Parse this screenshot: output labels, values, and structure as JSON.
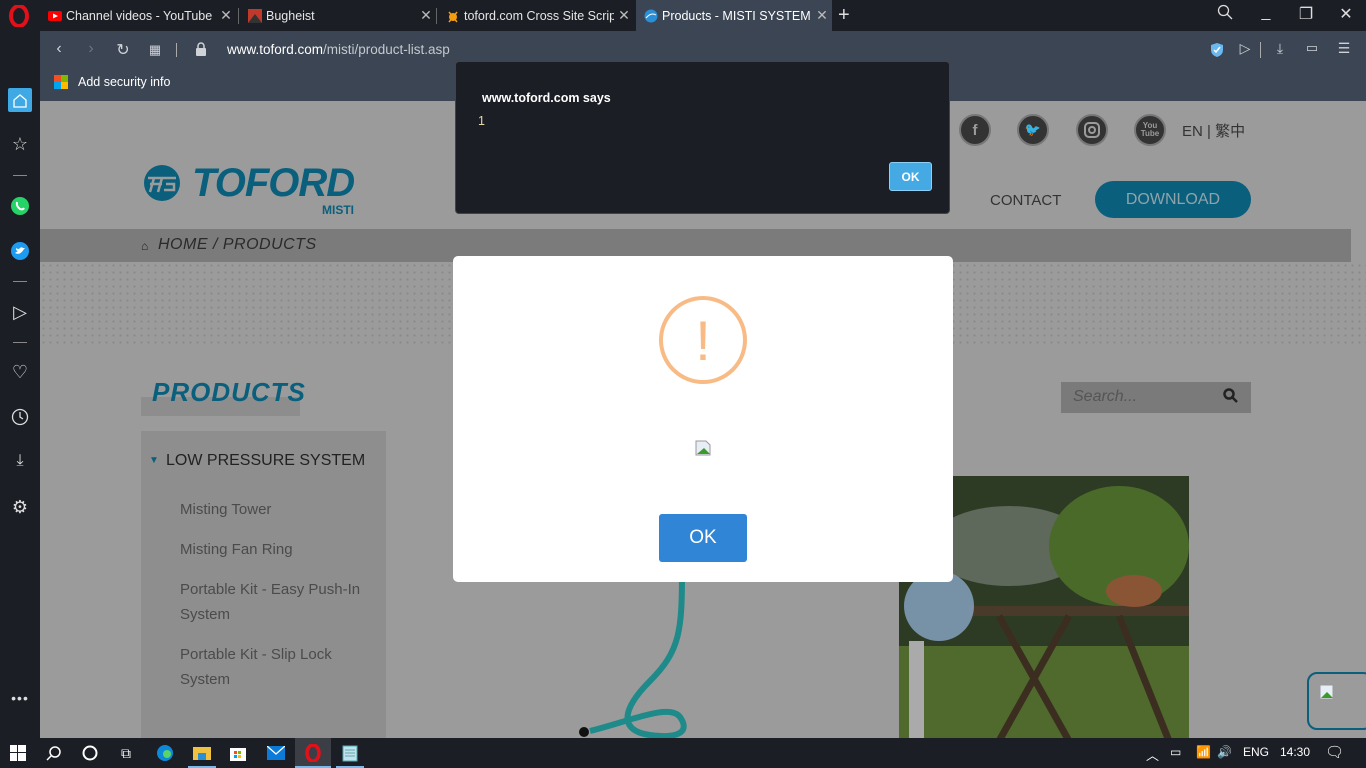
{
  "browser": {
    "tabs": [
      {
        "title": "Channel videos - YouTube Studio",
        "favicon": "youtube-icon",
        "active": false
      },
      {
        "title": "Bugheist",
        "favicon": "bugheist-icon",
        "active": false
      },
      {
        "title": "toford.com Cross Site Scripting",
        "favicon": "bug-icon",
        "active": false
      },
      {
        "title": "Products - MISTI SYSTEM",
        "favicon": "globe-icon",
        "active": true
      }
    ],
    "url_domain": "www.toford.com",
    "url_path": "/misti/product-list.asp",
    "bookmark": "Add security info",
    "sidebar_icons": [
      "home-icon",
      "star-icon",
      "whatsapp-icon",
      "twitter-icon",
      "send-icon",
      "heart-icon",
      "history-icon",
      "download-icon",
      "settings-icon",
      "more-icon"
    ]
  },
  "site": {
    "social": [
      "facebook",
      "twitter",
      "instagram",
      "youtube"
    ],
    "lang_en": "EN",
    "lang_sep": "|",
    "lang_zh": "繁中",
    "logo": "TOFORD",
    "logo_sub": "MISTI",
    "nav_contact": "CONTACT",
    "nav_download": "DOWNLOAD",
    "breadcrumb": "HOME / PRODUCTS",
    "products_title": "PRODUCTS",
    "search_placeholder": "Search...",
    "menu": {
      "category": "LOW PRESSURE SYSTEM",
      "items": [
        "Misting Tower",
        "Misting Fan Ring",
        "Portable Kit - Easy Push-In System",
        "Portable Kit - Slip Lock System"
      ]
    }
  },
  "sweet_alert": {
    "icon": "!",
    "ok": "OK"
  },
  "js_alert": {
    "title": "www.toford.com says",
    "message": "1",
    "ok": "OK"
  },
  "taskbar": {
    "apps": [
      "start",
      "search",
      "cortana",
      "task-view",
      "edge",
      "file-explorer",
      "store",
      "mail",
      "opera",
      "notepad"
    ],
    "lang": "ENG",
    "time": "14:30"
  }
}
